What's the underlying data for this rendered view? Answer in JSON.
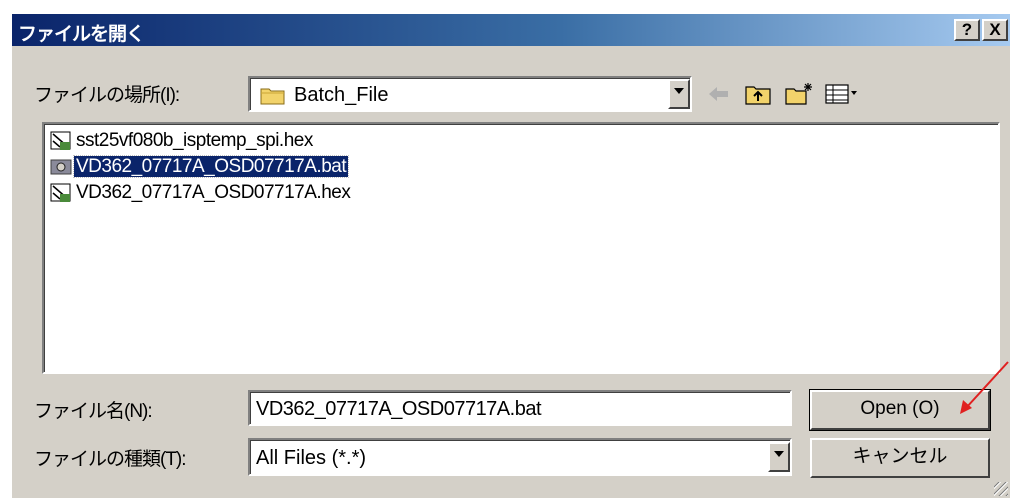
{
  "dialog": {
    "title": "ファイルを開く",
    "help_button": "?",
    "close_button": "X"
  },
  "location": {
    "label": "ファイルの場所(I):",
    "folder": "Batch_File"
  },
  "toolbar": {
    "icons": [
      "back-icon",
      "up-folder-icon",
      "new-folder-icon",
      "view-menu-icon"
    ]
  },
  "files": [
    {
      "name": "sst25vf080b_isptemp_spi.hex",
      "icon": "hex-file-icon",
      "selected": false
    },
    {
      "name": "VD362_07717A_OSD07717A.bat",
      "icon": "bat-file-icon",
      "selected": true
    },
    {
      "name": "VD362_07717A_OSD07717A.hex",
      "icon": "hex-file-icon",
      "selected": false
    }
  ],
  "filename": {
    "label": "ファイル名(N):",
    "value": "VD362_07717A_OSD07717A.bat"
  },
  "filetype": {
    "label": "ファイルの種類(T):",
    "value": "All Files (*.*)"
  },
  "buttons": {
    "open": "Open (O)",
    "cancel": "キャンセル"
  },
  "colors": {
    "selection": "#0a246a",
    "titlebar_start": "#0a246a",
    "titlebar_end": "#a6caf0",
    "annotation_arrow": "#e02020"
  }
}
